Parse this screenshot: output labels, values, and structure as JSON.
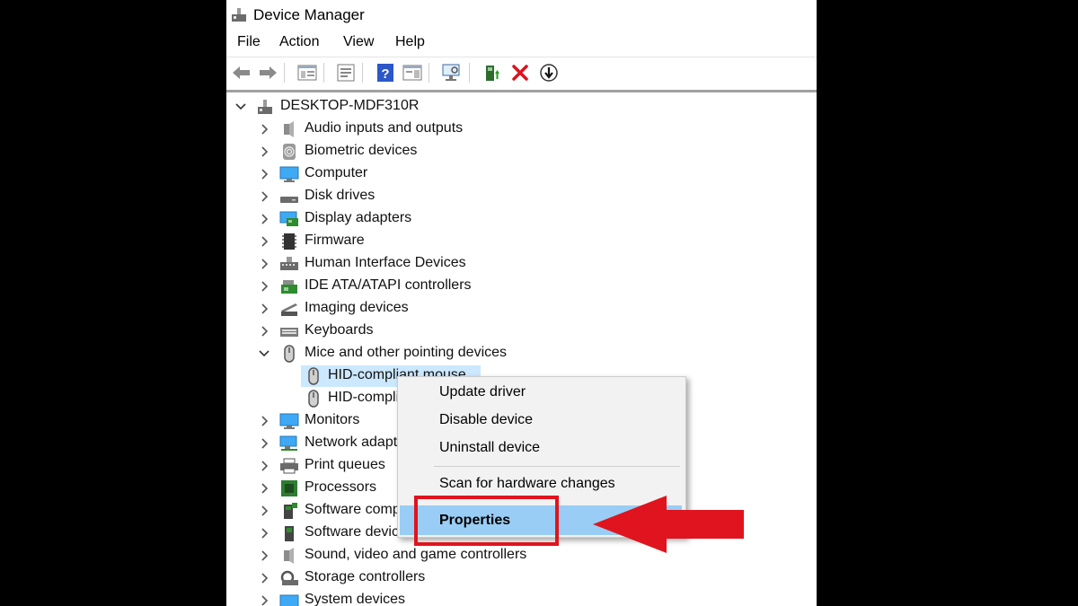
{
  "window": {
    "title": "Device Manager"
  },
  "menu": [
    "File",
    "Action",
    "View",
    "Help"
  ],
  "toolbar": [
    "back-icon",
    "forward-icon",
    "show-hide-console-tree-icon",
    "properties-icon",
    "help-icon",
    "action-pane-icon",
    "scan-hardware-icon",
    "update-driver-icon",
    "uninstall-icon",
    "disable-device-icon"
  ],
  "tree": {
    "root": "DESKTOP-MDF310R",
    "categories": [
      "Audio inputs and outputs",
      "Biometric devices",
      "Computer",
      "Disk drives",
      "Display adapters",
      "Firmware",
      "Human Interface Devices",
      "IDE ATA/ATAPI controllers",
      "Imaging devices",
      "Keyboards",
      "Mice and other pointing devices"
    ],
    "mice_children": [
      "HID-compliant mouse",
      "HID-compliant mouse"
    ],
    "more_categories": [
      "Monitors",
      "Network adapters",
      "Print queues",
      "Processors",
      "Software components",
      "Software devices",
      "Sound, video and game controllers",
      "Storage controllers",
      "System devices"
    ]
  },
  "context_menu": {
    "items": [
      "Update driver",
      "Disable device",
      "Uninstall device",
      "Scan for hardware changes",
      "Properties"
    ],
    "highlighted": "Properties"
  },
  "colors": {
    "selection": "#cce8ff",
    "menu_highlight": "#99cdf5",
    "callout": "#e0141e"
  }
}
